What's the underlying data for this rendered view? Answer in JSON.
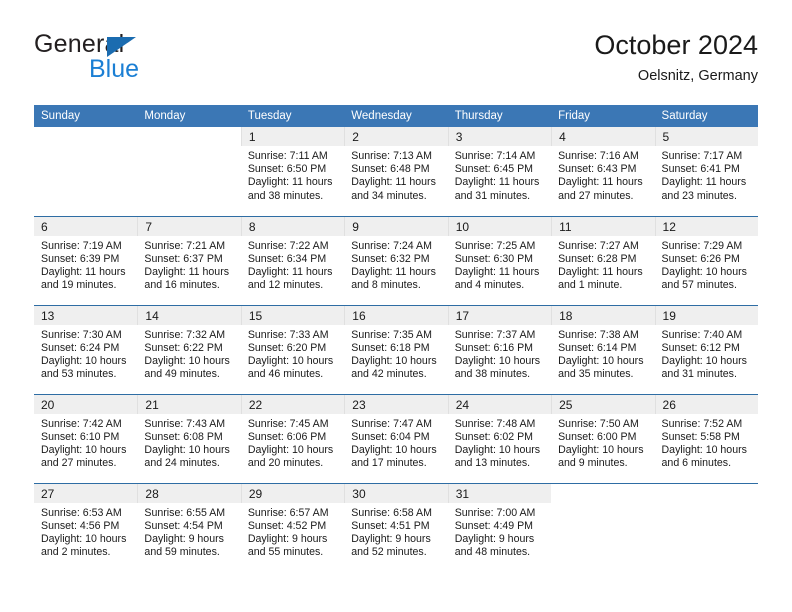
{
  "brand": {
    "name_top": "General",
    "name_bottom": "Blue",
    "triangle_color": "#1b6cb0",
    "blue_color": "#1b7fd4"
  },
  "header": {
    "title": "October 2024",
    "subtitle": "Oelsnitz, Germany",
    "accent_color": "#3b77b5"
  },
  "labels": {
    "sunrise": "Sunrise:",
    "sunset": "Sunset:",
    "daylight": "Daylight:"
  },
  "weekdays": [
    "Sunday",
    "Monday",
    "Tuesday",
    "Wednesday",
    "Thursday",
    "Friday",
    "Saturday"
  ],
  "weeks": [
    [
      {
        "day": "",
        "sunrise": "",
        "sunset": "",
        "daylight1": "",
        "daylight2": ""
      },
      {
        "day": "",
        "sunrise": "",
        "sunset": "",
        "daylight1": "",
        "daylight2": ""
      },
      {
        "day": "1",
        "sunrise": "Sunrise: 7:11 AM",
        "sunset": "Sunset: 6:50 PM",
        "daylight1": "Daylight: 11 hours",
        "daylight2": "and 38 minutes."
      },
      {
        "day": "2",
        "sunrise": "Sunrise: 7:13 AM",
        "sunset": "Sunset: 6:48 PM",
        "daylight1": "Daylight: 11 hours",
        "daylight2": "and 34 minutes."
      },
      {
        "day": "3",
        "sunrise": "Sunrise: 7:14 AM",
        "sunset": "Sunset: 6:45 PM",
        "daylight1": "Daylight: 11 hours",
        "daylight2": "and 31 minutes."
      },
      {
        "day": "4",
        "sunrise": "Sunrise: 7:16 AM",
        "sunset": "Sunset: 6:43 PM",
        "daylight1": "Daylight: 11 hours",
        "daylight2": "and 27 minutes."
      },
      {
        "day": "5",
        "sunrise": "Sunrise: 7:17 AM",
        "sunset": "Sunset: 6:41 PM",
        "daylight1": "Daylight: 11 hours",
        "daylight2": "and 23 minutes."
      }
    ],
    [
      {
        "day": "6",
        "sunrise": "Sunrise: 7:19 AM",
        "sunset": "Sunset: 6:39 PM",
        "daylight1": "Daylight: 11 hours",
        "daylight2": "and 19 minutes."
      },
      {
        "day": "7",
        "sunrise": "Sunrise: 7:21 AM",
        "sunset": "Sunset: 6:37 PM",
        "daylight1": "Daylight: 11 hours",
        "daylight2": "and 16 minutes."
      },
      {
        "day": "8",
        "sunrise": "Sunrise: 7:22 AM",
        "sunset": "Sunset: 6:34 PM",
        "daylight1": "Daylight: 11 hours",
        "daylight2": "and 12 minutes."
      },
      {
        "day": "9",
        "sunrise": "Sunrise: 7:24 AM",
        "sunset": "Sunset: 6:32 PM",
        "daylight1": "Daylight: 11 hours",
        "daylight2": "and 8 minutes."
      },
      {
        "day": "10",
        "sunrise": "Sunrise: 7:25 AM",
        "sunset": "Sunset: 6:30 PM",
        "daylight1": "Daylight: 11 hours",
        "daylight2": "and 4 minutes."
      },
      {
        "day": "11",
        "sunrise": "Sunrise: 7:27 AM",
        "sunset": "Sunset: 6:28 PM",
        "daylight1": "Daylight: 11 hours",
        "daylight2": "and 1 minute."
      },
      {
        "day": "12",
        "sunrise": "Sunrise: 7:29 AM",
        "sunset": "Sunset: 6:26 PM",
        "daylight1": "Daylight: 10 hours",
        "daylight2": "and 57 minutes."
      }
    ],
    [
      {
        "day": "13",
        "sunrise": "Sunrise: 7:30 AM",
        "sunset": "Sunset: 6:24 PM",
        "daylight1": "Daylight: 10 hours",
        "daylight2": "and 53 minutes."
      },
      {
        "day": "14",
        "sunrise": "Sunrise: 7:32 AM",
        "sunset": "Sunset: 6:22 PM",
        "daylight1": "Daylight: 10 hours",
        "daylight2": "and 49 minutes."
      },
      {
        "day": "15",
        "sunrise": "Sunrise: 7:33 AM",
        "sunset": "Sunset: 6:20 PM",
        "daylight1": "Daylight: 10 hours",
        "daylight2": "and 46 minutes."
      },
      {
        "day": "16",
        "sunrise": "Sunrise: 7:35 AM",
        "sunset": "Sunset: 6:18 PM",
        "daylight1": "Daylight: 10 hours",
        "daylight2": "and 42 minutes."
      },
      {
        "day": "17",
        "sunrise": "Sunrise: 7:37 AM",
        "sunset": "Sunset: 6:16 PM",
        "daylight1": "Daylight: 10 hours",
        "daylight2": "and 38 minutes."
      },
      {
        "day": "18",
        "sunrise": "Sunrise: 7:38 AM",
        "sunset": "Sunset: 6:14 PM",
        "daylight1": "Daylight: 10 hours",
        "daylight2": "and 35 minutes."
      },
      {
        "day": "19",
        "sunrise": "Sunrise: 7:40 AM",
        "sunset": "Sunset: 6:12 PM",
        "daylight1": "Daylight: 10 hours",
        "daylight2": "and 31 minutes."
      }
    ],
    [
      {
        "day": "20",
        "sunrise": "Sunrise: 7:42 AM",
        "sunset": "Sunset: 6:10 PM",
        "daylight1": "Daylight: 10 hours",
        "daylight2": "and 27 minutes."
      },
      {
        "day": "21",
        "sunrise": "Sunrise: 7:43 AM",
        "sunset": "Sunset: 6:08 PM",
        "daylight1": "Daylight: 10 hours",
        "daylight2": "and 24 minutes."
      },
      {
        "day": "22",
        "sunrise": "Sunrise: 7:45 AM",
        "sunset": "Sunset: 6:06 PM",
        "daylight1": "Daylight: 10 hours",
        "daylight2": "and 20 minutes."
      },
      {
        "day": "23",
        "sunrise": "Sunrise: 7:47 AM",
        "sunset": "Sunset: 6:04 PM",
        "daylight1": "Daylight: 10 hours",
        "daylight2": "and 17 minutes."
      },
      {
        "day": "24",
        "sunrise": "Sunrise: 7:48 AM",
        "sunset": "Sunset: 6:02 PM",
        "daylight1": "Daylight: 10 hours",
        "daylight2": "and 13 minutes."
      },
      {
        "day": "25",
        "sunrise": "Sunrise: 7:50 AM",
        "sunset": "Sunset: 6:00 PM",
        "daylight1": "Daylight: 10 hours",
        "daylight2": "and 9 minutes."
      },
      {
        "day": "26",
        "sunrise": "Sunrise: 7:52 AM",
        "sunset": "Sunset: 5:58 PM",
        "daylight1": "Daylight: 10 hours",
        "daylight2": "and 6 minutes."
      }
    ],
    [
      {
        "day": "27",
        "sunrise": "Sunrise: 6:53 AM",
        "sunset": "Sunset: 4:56 PM",
        "daylight1": "Daylight: 10 hours",
        "daylight2": "and 2 minutes."
      },
      {
        "day": "28",
        "sunrise": "Sunrise: 6:55 AM",
        "sunset": "Sunset: 4:54 PM",
        "daylight1": "Daylight: 9 hours",
        "daylight2": "and 59 minutes."
      },
      {
        "day": "29",
        "sunrise": "Sunrise: 6:57 AM",
        "sunset": "Sunset: 4:52 PM",
        "daylight1": "Daylight: 9 hours",
        "daylight2": "and 55 minutes."
      },
      {
        "day": "30",
        "sunrise": "Sunrise: 6:58 AM",
        "sunset": "Sunset: 4:51 PM",
        "daylight1": "Daylight: 9 hours",
        "daylight2": "and 52 minutes."
      },
      {
        "day": "31",
        "sunrise": "Sunrise: 7:00 AM",
        "sunset": "Sunset: 4:49 PM",
        "daylight1": "Daylight: 9 hours",
        "daylight2": "and 48 minutes."
      },
      {
        "day": "",
        "sunrise": "",
        "sunset": "",
        "daylight1": "",
        "daylight2": ""
      },
      {
        "day": "",
        "sunrise": "",
        "sunset": "",
        "daylight1": "",
        "daylight2": ""
      }
    ]
  ]
}
